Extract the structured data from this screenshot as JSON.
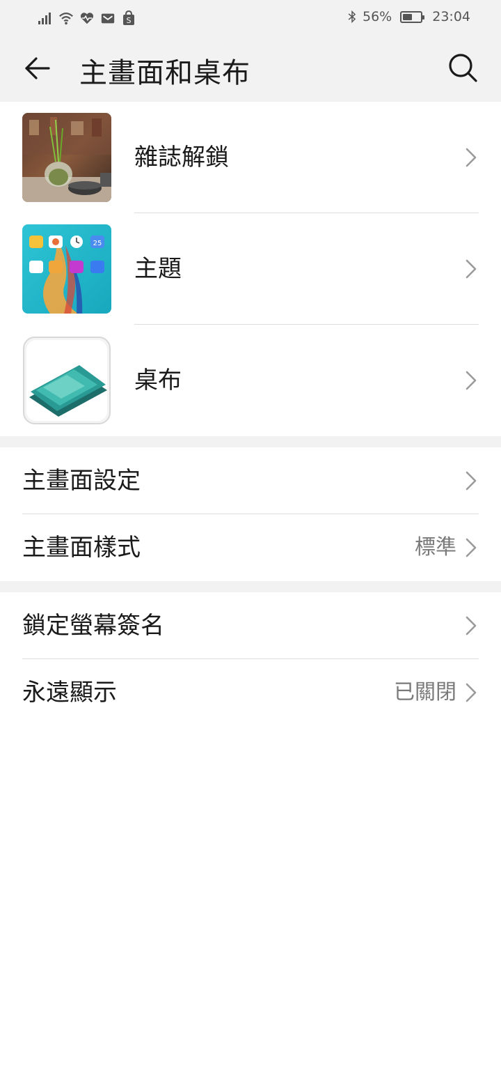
{
  "status_bar": {
    "battery_percent": "56%",
    "time": "23:04",
    "battery_level": 0.56,
    "left_icons": [
      "signal-icon",
      "wifi-icon",
      "heart-icon",
      "mail-icon",
      "shop-icon"
    ],
    "right_icons": [
      "bluetooth-icon",
      "battery-icon"
    ]
  },
  "header": {
    "title": "主畫面和桌布",
    "back_icon": "back-arrow-icon",
    "search_icon": "search-icon"
  },
  "thumb_items": [
    {
      "label": "雜誌解鎖",
      "icon": "magazine-unlock-thumbnail"
    },
    {
      "label": "主題",
      "icon": "theme-thumbnail"
    },
    {
      "label": "桌布",
      "icon": "wallpaper-thumbnail"
    }
  ],
  "home_settings": [
    {
      "label": "主畫面設定",
      "value": ""
    },
    {
      "label": "主畫面樣式",
      "value": "標準"
    }
  ],
  "lock_settings": [
    {
      "label": "鎖定螢幕簽名",
      "value": ""
    },
    {
      "label": "永遠顯示",
      "value": "已關閉"
    }
  ],
  "colors": {
    "background": "#ffffff",
    "header_background": "#f2f2f2",
    "text_primary": "#1a1a1a",
    "text_secondary": "#7a7a7a",
    "divider": "#dcdcdc",
    "chevron": "#9a9a9a"
  }
}
